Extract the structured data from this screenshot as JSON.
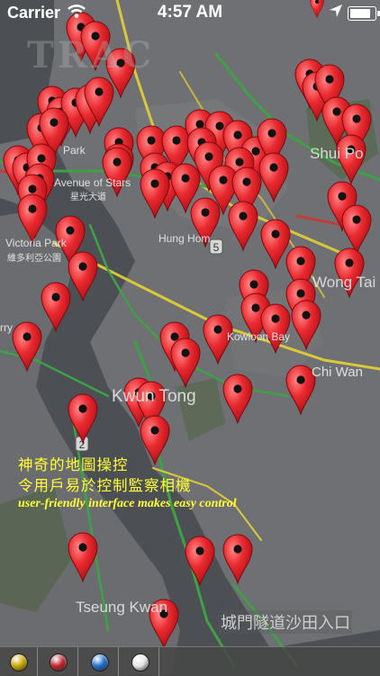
{
  "status_bar": {
    "carrier": "Carrier",
    "time": "4:57 AM",
    "wifi_icon": "wifi-icon",
    "location_icon": "location-arrow-icon",
    "battery_icon": "battery-icon"
  },
  "watermark": "TRAC",
  "map_labels": {
    "park": "Park",
    "avenue_of_stars": "Avenue of Stars",
    "avenue_zh": "星光大道",
    "victoria_park": "Victoria Park",
    "victoria_park_zh": "維多利亞公園",
    "hung_hom": "Hung Hom",
    "shui_po": "Shui Po",
    "wong_tai": "Wong Tai",
    "kowloon_bay": "Kowloon Bay",
    "chi_wan": "Chi Wan",
    "kwun_tong": "Kwun Tong",
    "tseung_kwan": "Tseung Kwan",
    "route_5": "5",
    "route_2": "2",
    "rry": "rry"
  },
  "caption": {
    "line1": "神奇的地圖操控",
    "line2": "令用戶易於控制監察相機",
    "line3": "user-friendly interface makes easy control"
  },
  "tunnel_label": "城門隧道沙田入口",
  "bottom_bar": {
    "buttons": [
      {
        "name": "yellow-filter-button",
        "color": "#c9a800"
      },
      {
        "name": "red-filter-button",
        "color": "#c0262b"
      },
      {
        "name": "blue-filter-button",
        "color": "#1f6fd1"
      },
      {
        "name": "white-filter-button",
        "color": "#e6e6e6"
      }
    ]
  },
  "colors": {
    "pin": "#e8262e",
    "caption": "#ffff33",
    "water": "#4c5055",
    "land": "#6c6d70"
  }
}
